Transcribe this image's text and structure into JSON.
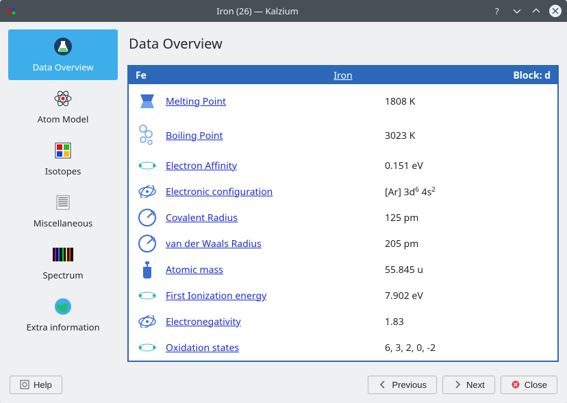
{
  "titlebar": {
    "title": "Iron (26) — Kalzium"
  },
  "sidebar": {
    "items": [
      {
        "label": "Data Overview"
      },
      {
        "label": "Atom Model"
      },
      {
        "label": "Isotopes"
      },
      {
        "label": "Miscellaneous"
      },
      {
        "label": "Spectrum"
      },
      {
        "label": "Extra information"
      }
    ]
  },
  "main": {
    "heading": "Data Overview",
    "header": {
      "symbol": "Fe",
      "name": "Iron",
      "block": "Block: d"
    },
    "rows": [
      {
        "label": "Melting Point",
        "value": "1808 K"
      },
      {
        "label": "Boiling Point",
        "value": "3023 K"
      },
      {
        "label": "Electron Affinity",
        "value": "0.151 eV"
      },
      {
        "label": "Electronic configuration",
        "value_html": "[Ar] 3d<sup>6</sup> 4s<sup>2</sup>"
      },
      {
        "label": "Covalent Radius",
        "value": "125 pm"
      },
      {
        "label": "van der Waals Radius",
        "value": "205 pm"
      },
      {
        "label": "Atomic mass",
        "value": "55.845 u"
      },
      {
        "label": "First Ionization energy",
        "value": "7.902 eV"
      },
      {
        "label": "Electronegativity",
        "value": "1.83"
      },
      {
        "label": "Oxidation states",
        "value": "6, 3, 2, 0, -2"
      }
    ]
  },
  "footer": {
    "help": "Help",
    "previous": "Previous",
    "next": "Next",
    "close": "Close"
  }
}
